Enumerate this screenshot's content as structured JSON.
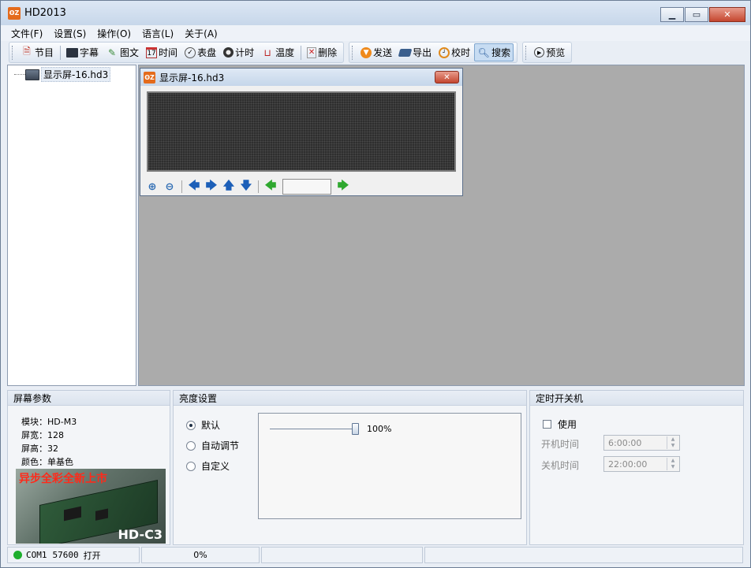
{
  "app": {
    "title": "HD2013",
    "icon_text": "ʘZ"
  },
  "colors": {
    "accent": "#e46b1c",
    "status_ok": "#1dae2d",
    "ad_text": "#ff2a1a"
  },
  "menu": [
    "文件(F)",
    "设置(S)",
    "操作(O)",
    "语言(L)",
    "关于(A)"
  ],
  "toolbar": {
    "group1": [
      {
        "label": "节目",
        "icon": "page-icon"
      },
      {
        "label": "字幕",
        "icon": "subtitle-icon"
      },
      {
        "label": "图文",
        "icon": "image-text-icon"
      },
      {
        "label": "时间",
        "icon": "calendar-icon"
      },
      {
        "label": "表盘",
        "icon": "clock-dial-icon"
      },
      {
        "label": "计时",
        "icon": "timer-icon"
      },
      {
        "label": "温度",
        "icon": "temperature-icon"
      },
      {
        "label": "删除",
        "icon": "delete-icon"
      }
    ],
    "group2": [
      {
        "label": "发送",
        "icon": "send-icon"
      },
      {
        "label": "导出",
        "icon": "export-icon"
      },
      {
        "label": "校时",
        "icon": "sync-time-icon"
      },
      {
        "label": "搜索",
        "icon": "search-icon",
        "active": true
      }
    ],
    "group3": [
      {
        "label": "预览",
        "icon": "preview-icon"
      }
    ]
  },
  "tree": {
    "node_label": "显示屏-16.hd3"
  },
  "child_window": {
    "title": "显示屏-16.hd3",
    "page_value": ""
  },
  "screen_params": {
    "header": "屏幕参数",
    "module": "模块：HD-M3",
    "width": "屏宽：128",
    "height": "屏高：32",
    "color": "颜色：单基色",
    "ad_text": "异步全彩全新上市",
    "ad_model": "HD-C3"
  },
  "brightness": {
    "header": "亮度设置",
    "options": [
      "默认",
      "自动调节",
      "自定义"
    ],
    "selected": 0,
    "value": "100%",
    "level": 1.0
  },
  "timer_power": {
    "header": "定时开关机",
    "use_label": "使用",
    "on_label": "开机时间",
    "on_value": "6:00:00",
    "off_label": "关机时间",
    "off_value": "22:00:00"
  },
  "status": {
    "port": "COM1",
    "baud": "57600",
    "state": "打开",
    "progress": "0%"
  }
}
